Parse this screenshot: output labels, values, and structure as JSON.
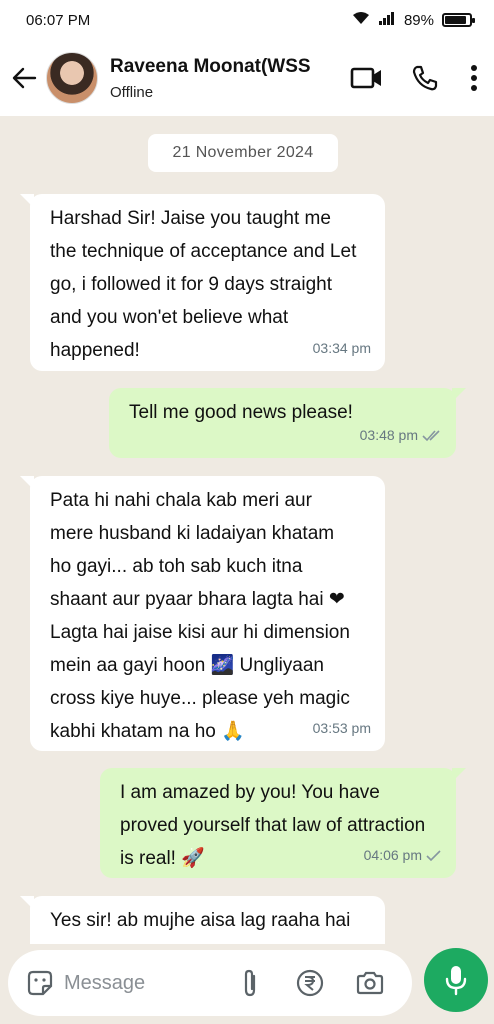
{
  "status_bar": {
    "time": "06:07 PM",
    "battery_percent": "89%",
    "battery_level": 0.89
  },
  "header": {
    "contact_name": "Raveena Moonat(WSS",
    "contact_status": "Offline"
  },
  "chat": {
    "date_chip": "21 November 2024",
    "messages": [
      {
        "direction": "in",
        "text": "Harshad Sir! Jaise you taught me\nthe technique of acceptance and Let\ngo, i followed it for 9 days straight\nand you won'et believe what\nhappened!",
        "time": "03:34 pm"
      },
      {
        "direction": "out",
        "text": "Tell me good news please!",
        "time": "03:48 pm"
      },
      {
        "direction": "in",
        "text": "Pata hi nahi chala kab meri aur\nmere husband ki ladaiyan khatam\nho gayi... ab toh sab kuch itna\nshaant aur pyaar bhara lagta hai ❤\nLagta hai jaise kisi aur hi dimension\nmein aa gayi hoon 🌌 Ungliyaan\ncross kiye huye... please yeh magic\nkabhi khatam na ho 🙏",
        "time": "03:53 pm"
      },
      {
        "direction": "out",
        "text": "I am amazed by you! You have\nproved yourself that law of attraction\nis real! 🚀",
        "time": "04:06 pm"
      },
      {
        "direction": "in",
        "text": "Yes sir! ab mujhe aisa lag raaha hai",
        "time": ""
      }
    ]
  },
  "composer": {
    "placeholder": "Message"
  },
  "colors": {
    "accent": "#1daa61",
    "outgoing_bubble": "#dcf8c6",
    "chat_bg": "#efeae2"
  }
}
